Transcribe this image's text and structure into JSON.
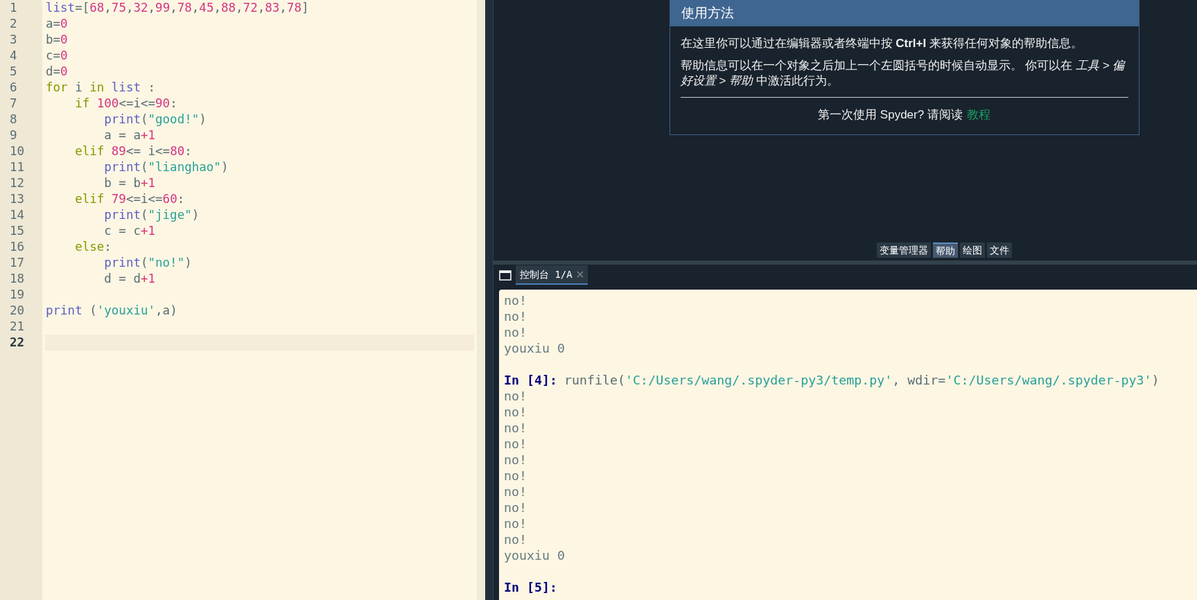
{
  "editor": {
    "lines": [
      {
        "number": "1",
        "current": false,
        "tokens": [
          {
            "kind": "builtin",
            "text": "list"
          },
          {
            "kind": "plain",
            "text": "=["
          },
          {
            "kind": "number",
            "text": "68"
          },
          {
            "kind": "plain",
            "text": ","
          },
          {
            "kind": "number",
            "text": "75"
          },
          {
            "kind": "plain",
            "text": ","
          },
          {
            "kind": "number",
            "text": "32"
          },
          {
            "kind": "plain",
            "text": ","
          },
          {
            "kind": "number",
            "text": "99"
          },
          {
            "kind": "plain",
            "text": ","
          },
          {
            "kind": "number",
            "text": "78"
          },
          {
            "kind": "plain",
            "text": ","
          },
          {
            "kind": "number",
            "text": "45"
          },
          {
            "kind": "plain",
            "text": ","
          },
          {
            "kind": "number",
            "text": "88"
          },
          {
            "kind": "plain",
            "text": ","
          },
          {
            "kind": "number",
            "text": "72"
          },
          {
            "kind": "plain",
            "text": ","
          },
          {
            "kind": "number",
            "text": "83"
          },
          {
            "kind": "plain",
            "text": ","
          },
          {
            "kind": "number",
            "text": "78"
          },
          {
            "kind": "plain",
            "text": "]"
          }
        ]
      },
      {
        "number": "2",
        "current": false,
        "tokens": [
          {
            "kind": "plain",
            "text": "a="
          },
          {
            "kind": "number",
            "text": "0"
          }
        ]
      },
      {
        "number": "3",
        "current": false,
        "tokens": [
          {
            "kind": "plain",
            "text": "b="
          },
          {
            "kind": "number",
            "text": "0"
          }
        ]
      },
      {
        "number": "4",
        "current": false,
        "tokens": [
          {
            "kind": "plain",
            "text": "c="
          },
          {
            "kind": "number",
            "text": "0"
          }
        ]
      },
      {
        "number": "5",
        "current": false,
        "tokens": [
          {
            "kind": "plain",
            "text": "d="
          },
          {
            "kind": "number",
            "text": "0"
          }
        ]
      },
      {
        "number": "6",
        "current": false,
        "tokens": [
          {
            "kind": "keyword",
            "text": "for"
          },
          {
            "kind": "plain",
            "text": " i "
          },
          {
            "kind": "keyword",
            "text": "in"
          },
          {
            "kind": "builtin",
            "text": " list"
          },
          {
            "kind": "plain",
            "text": " :"
          }
        ]
      },
      {
        "number": "7",
        "current": false,
        "tokens": [
          {
            "kind": "keyword",
            "text": "    if"
          },
          {
            "kind": "number",
            "text": " 100"
          },
          {
            "kind": "plain",
            "text": "<=i<="
          },
          {
            "kind": "number",
            "text": "90"
          },
          {
            "kind": "plain",
            "text": ":"
          }
        ]
      },
      {
        "number": "8",
        "current": false,
        "tokens": [
          {
            "kind": "builtin",
            "text": "        print"
          },
          {
            "kind": "plain",
            "text": "("
          },
          {
            "kind": "string",
            "text": "\"good!\""
          },
          {
            "kind": "plain",
            "text": ")"
          }
        ]
      },
      {
        "number": "9",
        "current": false,
        "tokens": [
          {
            "kind": "plain",
            "text": "        a = a"
          },
          {
            "kind": "number",
            "text": "+1"
          }
        ]
      },
      {
        "number": "10",
        "current": false,
        "tokens": [
          {
            "kind": "keyword",
            "text": "    elif"
          },
          {
            "kind": "number",
            "text": " 89"
          },
          {
            "kind": "plain",
            "text": "<= i<="
          },
          {
            "kind": "number",
            "text": "80"
          },
          {
            "kind": "plain",
            "text": ":"
          }
        ]
      },
      {
        "number": "11",
        "current": false,
        "tokens": [
          {
            "kind": "builtin",
            "text": "        print"
          },
          {
            "kind": "plain",
            "text": "("
          },
          {
            "kind": "string",
            "text": "\"lianghao\""
          },
          {
            "kind": "plain",
            "text": ")"
          }
        ]
      },
      {
        "number": "12",
        "current": false,
        "tokens": [
          {
            "kind": "plain",
            "text": "        b = b"
          },
          {
            "kind": "number",
            "text": "+1"
          }
        ]
      },
      {
        "number": "13",
        "current": false,
        "tokens": [
          {
            "kind": "keyword",
            "text": "    elif"
          },
          {
            "kind": "number",
            "text": " 79"
          },
          {
            "kind": "plain",
            "text": "<=i<="
          },
          {
            "kind": "number",
            "text": "60"
          },
          {
            "kind": "plain",
            "text": ":"
          }
        ]
      },
      {
        "number": "14",
        "current": false,
        "tokens": [
          {
            "kind": "builtin",
            "text": "        print"
          },
          {
            "kind": "plain",
            "text": "("
          },
          {
            "kind": "string",
            "text": "\"jige\""
          },
          {
            "kind": "plain",
            "text": ")"
          }
        ]
      },
      {
        "number": "15",
        "current": false,
        "tokens": [
          {
            "kind": "plain",
            "text": "        c = c"
          },
          {
            "kind": "number",
            "text": "+1"
          }
        ]
      },
      {
        "number": "16",
        "current": false,
        "tokens": [
          {
            "kind": "keyword",
            "text": "    else"
          },
          {
            "kind": "plain",
            "text": ":"
          }
        ]
      },
      {
        "number": "17",
        "current": false,
        "tokens": [
          {
            "kind": "builtin",
            "text": "        print"
          },
          {
            "kind": "plain",
            "text": "("
          },
          {
            "kind": "string",
            "text": "\"no!\""
          },
          {
            "kind": "plain",
            "text": ")"
          }
        ]
      },
      {
        "number": "18",
        "current": false,
        "tokens": [
          {
            "kind": "plain",
            "text": "        d = d"
          },
          {
            "kind": "number",
            "text": "+1"
          }
        ]
      },
      {
        "number": "19",
        "current": false
      },
      {
        "number": "20",
        "current": false,
        "tokens": [
          {
            "kind": "builtin",
            "text": "print"
          },
          {
            "kind": "plain",
            "text": " ("
          },
          {
            "kind": "string",
            "text": "'youxiu'"
          },
          {
            "kind": "plain",
            "text": ",a)"
          }
        ]
      },
      {
        "number": "21",
        "current": false
      },
      {
        "number": "22",
        "current": true
      }
    ]
  },
  "help": {
    "title": "使用方法",
    "paragraphs": [
      "在这里你可以通过在编辑器或者终端中按 **Ctrl+I** 来获得任何对象的帮助信息。",
      "帮助信息可以在一个对象之后加上一个左圆括号的时候自动显示。 你可以在 *工具 > 偏好设置 > 帮助* 中激活此行为。"
    ],
    "footer": {
      "text": "第一次使用 Spyder? 请阅读",
      "link": "教程"
    }
  },
  "pane_tabs": [
    {
      "label": "变量管理器",
      "selected": false
    },
    {
      "label": "帮助",
      "selected": true
    },
    {
      "label": "绘图",
      "selected": false
    },
    {
      "label": "文件",
      "selected": false
    }
  ],
  "console": {
    "tab": {
      "label": "控制台 1/A",
      "selected": true
    },
    "lines": [
      {
        "kind": "output",
        "text": "no!"
      },
      {
        "kind": "output",
        "text": "no!"
      },
      {
        "kind": "output",
        "text": "no!"
      },
      {
        "kind": "output",
        "text": "youxiu 0"
      },
      {
        "kind": "blank"
      },
      {
        "kind": "prompt",
        "prompt": "In [4]:",
        "tokens": [
          {
            "kind": "plain",
            "text": "runfile("
          },
          {
            "kind": "string",
            "text": "'C:/Users/wang/.spyder-py3/temp.py'"
          },
          {
            "kind": "plain",
            "text": ", wdir="
          },
          {
            "kind": "string",
            "text": "'C:/Users/wang/.spyder-py3'"
          },
          {
            "kind": "plain",
            "text": ")"
          }
        ]
      },
      {
        "kind": "output",
        "text": "no!"
      },
      {
        "kind": "output",
        "text": "no!"
      },
      {
        "kind": "output",
        "text": "no!"
      },
      {
        "kind": "output",
        "text": "no!"
      },
      {
        "kind": "output",
        "text": "no!"
      },
      {
        "kind": "output",
        "text": "no!"
      },
      {
        "kind": "output",
        "text": "no!"
      },
      {
        "kind": "output",
        "text": "no!"
      },
      {
        "kind": "output",
        "text": "no!"
      },
      {
        "kind": "output",
        "text": "no!"
      },
      {
        "kind": "output",
        "text": "youxiu 0"
      },
      {
        "kind": "blank"
      },
      {
        "kind": "prompt",
        "prompt": "In [5]:"
      }
    ]
  }
}
